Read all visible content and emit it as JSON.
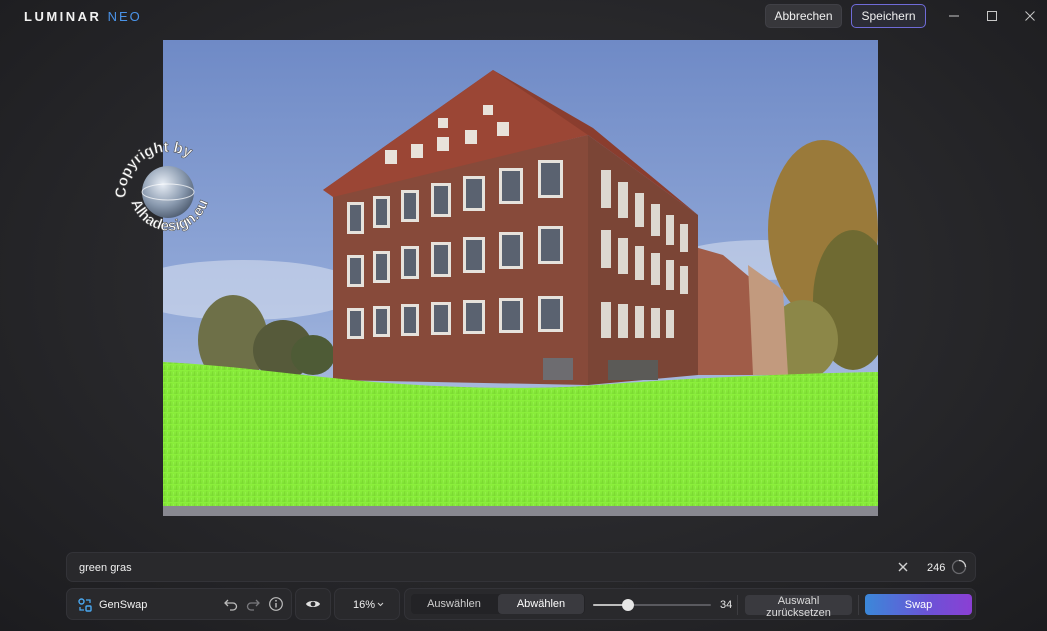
{
  "app": {
    "logo_main": "LUMINAR",
    "logo_accent": "NEO",
    "cancel_label": "Abbrechen",
    "save_label": "Speichern",
    "minimize_icon": "minimize-icon",
    "maximize_icon": "maximize-icon",
    "close_icon": "close-icon"
  },
  "photo": {
    "watermark_top": "Copyright by",
    "watermark_bottom": "Alhadesign.eu",
    "overlay_color": "#8ef23a"
  },
  "prompt": {
    "value": "green gras",
    "clear_icon": "clear-icon",
    "count": "246"
  },
  "toolbar": {
    "tool_name": "GenSwap",
    "undo_icon": "undo-icon",
    "redo_icon": "redo-icon",
    "info_icon": "info-icon",
    "eye_icon": "eye-icon",
    "zoom": "16%",
    "select_label": "Auswählen",
    "deselect_label": "Abwählen",
    "active_mode": "Abwählen",
    "brush_value": "34",
    "brush_fraction": 0.3,
    "reset_label": "Auswahl zurücksetzen",
    "swap_label": "Swap"
  },
  "colors": {
    "accent": "#6f6bd8",
    "swap_gradient_start": "#3b88d9",
    "swap_gradient_end": "#8b3fd4",
    "grass": "#8ef23a"
  }
}
